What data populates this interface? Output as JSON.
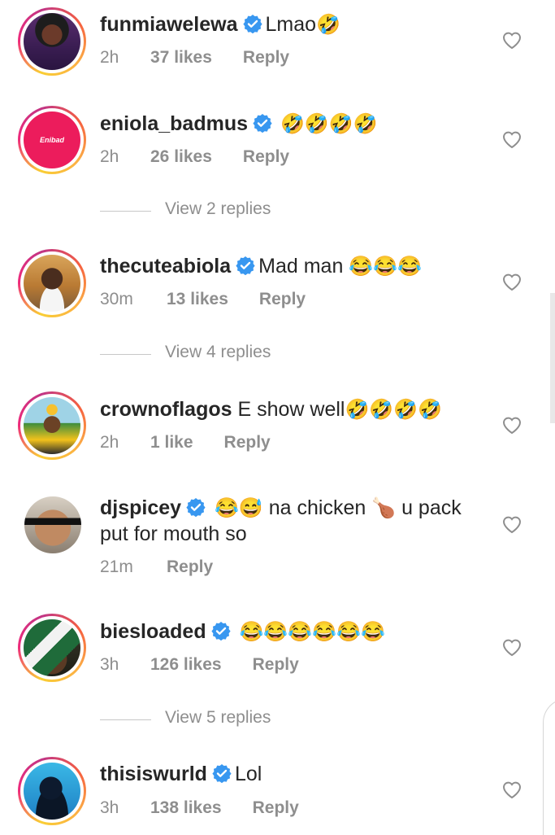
{
  "colors": {
    "verified": "#3897f0",
    "muted": "#8e8e8e",
    "text": "#262626"
  },
  "comments": [
    {
      "username": "funmiawelewa",
      "verified": true,
      "text": "Lmao",
      "emoji": "🤣",
      "time": "2h",
      "likes": "37 likes",
      "reply": "Reply",
      "avatar": "woman-portrait"
    },
    {
      "username": "eniola_badmus",
      "verified": true,
      "text": "",
      "emoji": "🤣🤣🤣🤣",
      "time": "2h",
      "likes": "26 likes",
      "reply": "Reply",
      "avatar": "enibad-logo",
      "avatar_text": "Enibad",
      "view_replies": "View 2 replies"
    },
    {
      "username": "thecuteabiola",
      "verified": true,
      "text": "Mad man",
      "emoji": "😂😂😂",
      "time": "30m",
      "likes": "13 likes",
      "reply": "Reply",
      "avatar": "man-portrait",
      "view_replies": "View 4 replies"
    },
    {
      "username": "crownoflagos",
      "verified": false,
      "text": "E show well",
      "emoji": "🤣🤣🤣🤣",
      "time": "2h",
      "likes": "1 like",
      "reply": "Reply",
      "avatar": "crown-cartoon"
    },
    {
      "username": "djspicey",
      "verified": true,
      "text": "na chicken",
      "emoji": "😂😅",
      "text2_emoji": "🍗",
      "text2": "u pack",
      "line2": "put for mouth so",
      "time": "21m",
      "likes": "",
      "reply": "Reply",
      "avatar": "man-sunglasses"
    },
    {
      "username": "biesloaded",
      "verified": true,
      "text": "",
      "emoji": "😂😂😂😂😂😂",
      "time": "3h",
      "likes": "126 likes",
      "reply": "Reply",
      "avatar": "flag-portrait",
      "view_replies": "View 5 replies"
    },
    {
      "username": "thisiswurld",
      "verified": true,
      "text": "Lol",
      "emoji": "",
      "time": "3h",
      "likes": "138 likes",
      "reply": "Reply",
      "avatar": "blue-portrait"
    }
  ]
}
